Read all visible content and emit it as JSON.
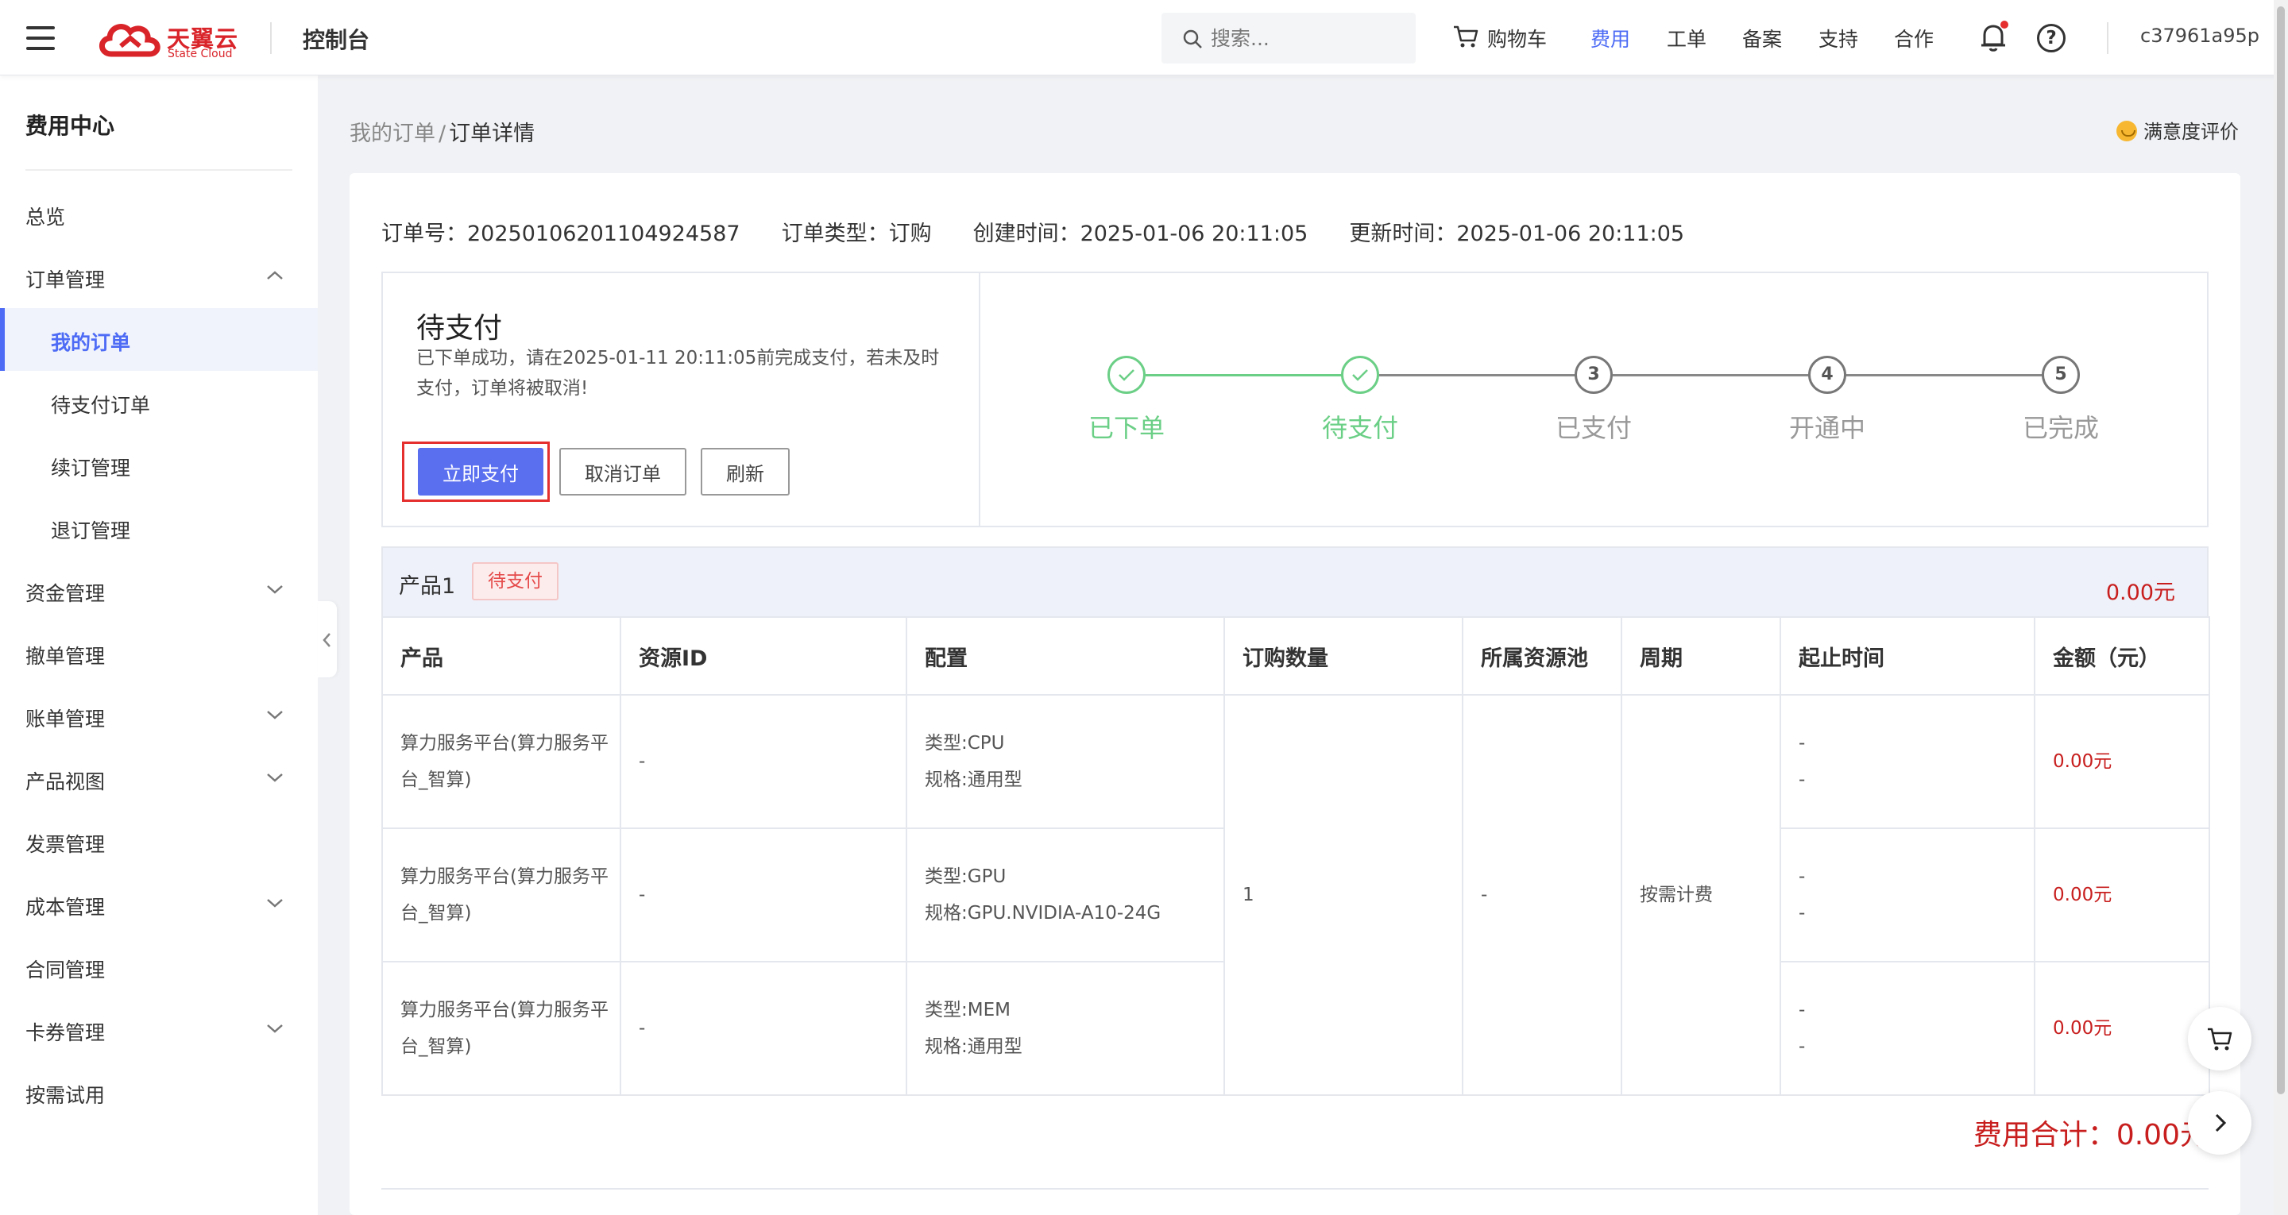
{
  "header": {
    "logo_cn": "天翼云",
    "logo_en": "State Cloud",
    "console_title": "控制台",
    "search_placeholder": "搜索...",
    "cart_label": "购物车",
    "nav": [
      {
        "label": "费用",
        "active": true
      },
      {
        "label": "工单",
        "active": false
      },
      {
        "label": "备案",
        "active": false
      },
      {
        "label": "支持",
        "active": false
      },
      {
        "label": "合作",
        "active": false
      }
    ],
    "help_label": "?",
    "user": "c37961a95p",
    "accent_color": "#4d6bf5"
  },
  "sidebar": {
    "title": "费用中心",
    "items": [
      {
        "label": "总览",
        "indent": false,
        "chevron": ""
      },
      {
        "label": "订单管理",
        "indent": false,
        "chevron": "up"
      },
      {
        "label": "我的订单",
        "indent": true,
        "chevron": "",
        "active": true
      },
      {
        "label": "待支付订单",
        "indent": true,
        "chevron": ""
      },
      {
        "label": "续订管理",
        "indent": true,
        "chevron": ""
      },
      {
        "label": "退订管理",
        "indent": true,
        "chevron": ""
      },
      {
        "label": "资金管理",
        "indent": false,
        "chevron": "down"
      },
      {
        "label": "撤单管理",
        "indent": false,
        "chevron": ""
      },
      {
        "label": "账单管理",
        "indent": false,
        "chevron": "down"
      },
      {
        "label": "产品视图",
        "indent": false,
        "chevron": "down"
      },
      {
        "label": "发票管理",
        "indent": false,
        "chevron": ""
      },
      {
        "label": "成本管理",
        "indent": false,
        "chevron": "down"
      },
      {
        "label": "合同管理",
        "indent": false,
        "chevron": ""
      },
      {
        "label": "卡券管理",
        "indent": false,
        "chevron": "down"
      },
      {
        "label": "按需试用",
        "indent": false,
        "chevron": ""
      }
    ]
  },
  "breadcrumb": {
    "parent": "我的订单",
    "separator": "/",
    "current": "订单详情"
  },
  "satisfaction_label": "满意度评价",
  "order": {
    "number": "订单号：20250106201104924587",
    "type": "订单类型：订购",
    "created": "创建时间：2025-01-06 20:11:05",
    "updated": "更新时间：2025-01-06 20:11:05"
  },
  "status": {
    "title": "待支付",
    "description": "已下单成功，请在2025-01-11 20:11:05前完成支付，若未及时支付，订单将被取消!",
    "pay_button": "立即支付",
    "cancel_button": "取消订单",
    "refresh_button": "刷新",
    "steps": [
      {
        "label": "已下单",
        "done": true,
        "number": "1"
      },
      {
        "label": "待支付",
        "done": true,
        "number": "2"
      },
      {
        "label": "已支付",
        "done": false,
        "number": "3"
      },
      {
        "label": "开通中",
        "done": false,
        "number": "4"
      },
      {
        "label": "已完成",
        "done": false,
        "number": "5"
      }
    ],
    "done_color": "#6bcf86"
  },
  "product": {
    "name": "产品1",
    "badge": "待支付",
    "amount": "0.00元"
  },
  "table": {
    "headers": [
      "产品",
      "资源ID",
      "配置",
      "订购数量",
      "所属资源池",
      "周期",
      "起止时间",
      "金额（元）"
    ],
    "rows": [
      {
        "product": "算力服务平台(算力服务平台_智算)",
        "resource_id": "-",
        "config_type": "类型:CPU",
        "config_spec": "规格:通用型",
        "time_start": "-",
        "time_end": "-",
        "amount": "0.00元"
      },
      {
        "product": "算力服务平台(算力服务平台_智算)",
        "resource_id": "-",
        "config_type": "类型:GPU",
        "config_spec": "规格:GPU.NVIDIA-A10-24G",
        "time_start": "-",
        "time_end": "-",
        "amount": "0.00元"
      },
      {
        "product": "算力服务平台(算力服务平台_智算)",
        "resource_id": "-",
        "config_type": "类型:MEM",
        "config_spec": "规格:通用型",
        "time_start": "-",
        "time_end": "-",
        "amount": "0.00元"
      }
    ],
    "shared_quantity": "1",
    "shared_pool": "-",
    "shared_period": "按需计费"
  },
  "total": "费用合计：0.00元",
  "price_color": "#c81e1e"
}
